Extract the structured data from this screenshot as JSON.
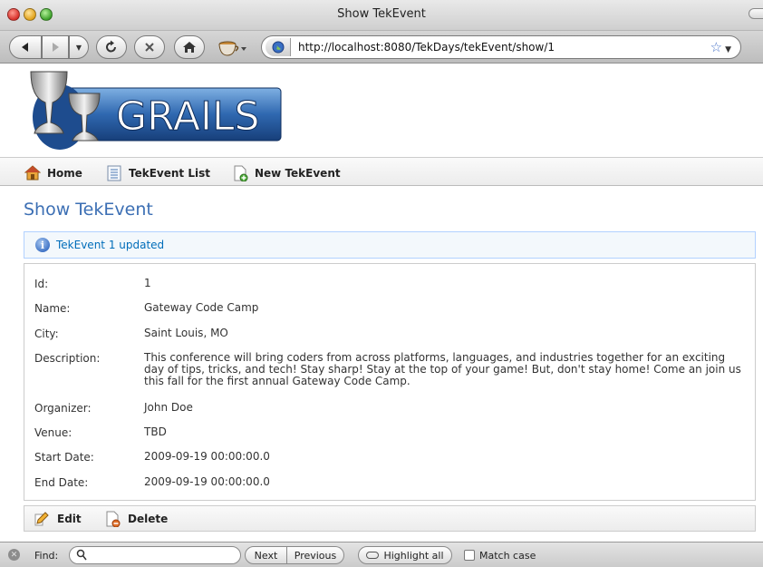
{
  "window": {
    "title": "Show TekEvent"
  },
  "browser": {
    "url": "http://localhost:8080/TekDays/tekEvent/show/1"
  },
  "logo": {
    "text": "GRAILS"
  },
  "nav": {
    "home": "Home",
    "list": "TekEvent List",
    "new": "New TekEvent"
  },
  "page": {
    "title": "Show TekEvent",
    "message": "TekEvent 1 updated"
  },
  "details": [
    {
      "label": "Id:",
      "value": "1"
    },
    {
      "label": "Name:",
      "value": "Gateway Code Camp"
    },
    {
      "label": "City:",
      "value": "Saint Louis, MO"
    },
    {
      "label": "Description:",
      "value": "This conference will bring coders from across platforms, languages, and industries together for an exciting day of tips, tricks, and tech! Stay sharp! Stay at the top of your game! But, don't stay home! Come an join us this fall for the first annual Gateway Code Camp."
    },
    {
      "label": "Organizer:",
      "value": "John Doe"
    },
    {
      "label": "Venue:",
      "value": "TBD"
    },
    {
      "label": "Start Date:",
      "value": "2009-09-19 00:00:00.0"
    },
    {
      "label": "End Date:",
      "value": "2009-09-19 00:00:00.0"
    }
  ],
  "actions": {
    "edit": "Edit",
    "delete": "Delete"
  },
  "findbar": {
    "label": "Find:",
    "value": "",
    "next": "Next",
    "previous": "Previous",
    "highlight": "Highlight all",
    "match_case": "Match case"
  },
  "colors": {
    "title_blue": "#3c6fb4",
    "message_bg": "#f3f8fc",
    "message_text": "#006dba"
  }
}
